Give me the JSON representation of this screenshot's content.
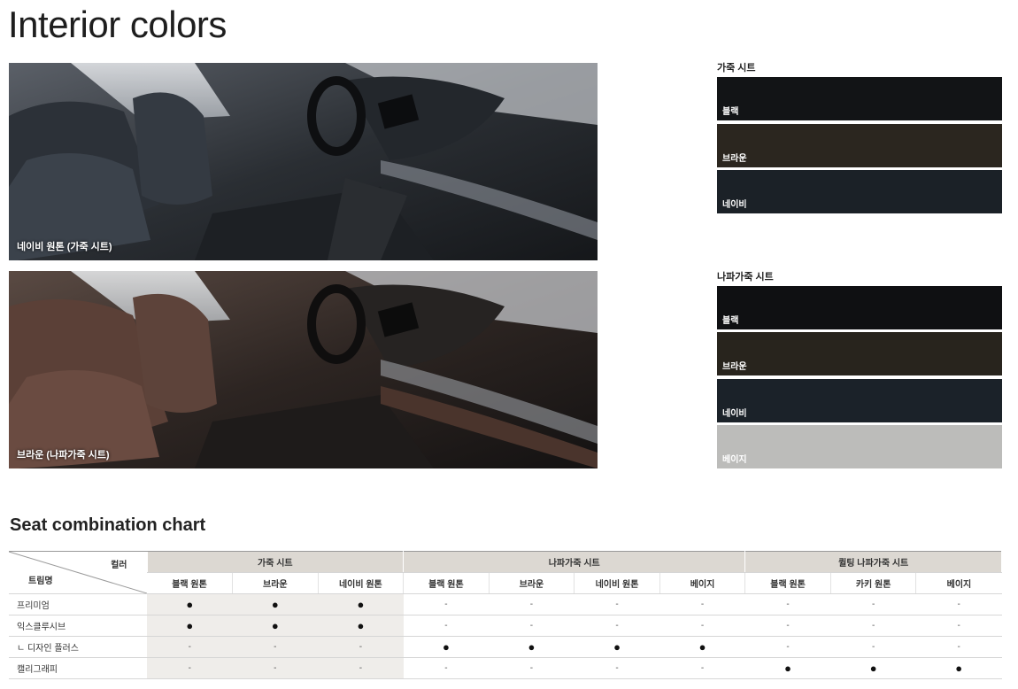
{
  "page": {
    "title": "Interior colors",
    "chart_title": "Seat combination chart"
  },
  "photos": [
    {
      "caption": "네이비 원톤 (가죽 시트)"
    },
    {
      "caption": "브라운 (나파가죽 시트)"
    }
  ],
  "swatch_groups": [
    {
      "title": "가죽 시트",
      "swatches": [
        {
          "label": "블랙",
          "color": "#121416"
        },
        {
          "label": "브라운",
          "color": "#2b261f"
        },
        {
          "label": "네이비",
          "color": "#1b2127"
        }
      ]
    },
    {
      "title": "나파가죽 시트",
      "swatches": [
        {
          "label": "블랙",
          "color": "#0f1012"
        },
        {
          "label": "브라운",
          "color": "#28241d"
        },
        {
          "label": "네이비",
          "color": "#1b2229"
        },
        {
          "label": "베이지",
          "color": "#bcbcba"
        }
      ]
    }
  ],
  "table": {
    "corner_top": "컬러",
    "corner_bottom": "트림명",
    "groups": [
      "가죽 시트",
      "나파가죽 시트",
      "퀼팅 나파가죽 시트"
    ],
    "columns": [
      "블랙 원톤",
      "브라운",
      "네이비 원톤",
      "블랙 원톤",
      "브라운",
      "네이비 원톤",
      "베이지",
      "블랙 원톤",
      "카키 원톤",
      "베이지"
    ],
    "rows": [
      {
        "name": "프리미엄",
        "cells": [
          "●",
          "●",
          "●",
          "-",
          "-",
          "-",
          "-",
          "-",
          "-",
          "-"
        ]
      },
      {
        "name": "익스클루시브",
        "cells": [
          "●",
          "●",
          "●",
          "-",
          "-",
          "-",
          "-",
          "-",
          "-",
          "-"
        ]
      },
      {
        "name": "ㄴ 디자인 플러스",
        "cells": [
          "-",
          "-",
          "-",
          "●",
          "●",
          "●",
          "●",
          "-",
          "-",
          "-"
        ]
      },
      {
        "name": "캘리그래피",
        "cells": [
          "-",
          "-",
          "-",
          "-",
          "-",
          "-",
          "-",
          "●",
          "●",
          "●"
        ]
      }
    ]
  }
}
